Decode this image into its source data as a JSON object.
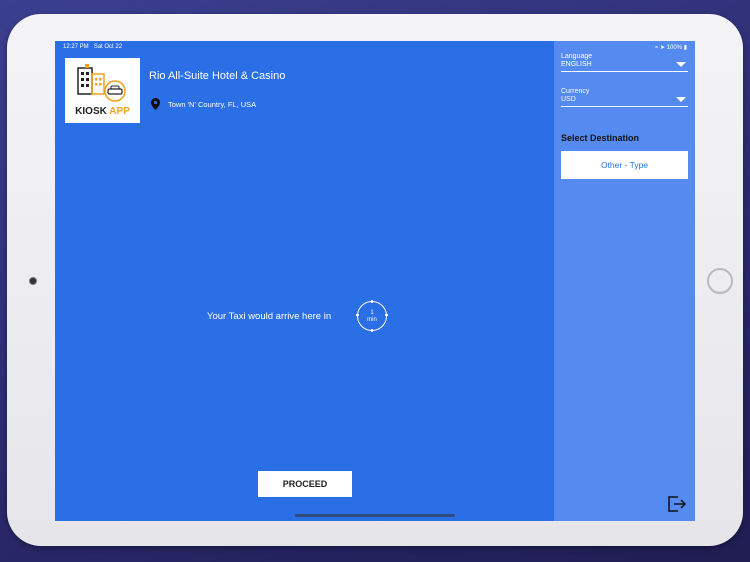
{
  "status_bar": {
    "time": "12:27 PM",
    "date": "Sat Oct 22",
    "battery": "100%"
  },
  "hotel": {
    "name": "Rio All-Suite Hotel & Casino",
    "location": "Town 'N' Country, FL, USA"
  },
  "logo": {
    "text_kiosk": "KIOSK",
    "text_app": "APP"
  },
  "taxi": {
    "arrival_text": "Your Taxi would arrive here in",
    "minutes": "1",
    "unit": "min"
  },
  "actions": {
    "proceed_label": "PROCEED"
  },
  "sidebar": {
    "language_label": "Language",
    "language_value": "ENGLISH",
    "currency_label": "Currency",
    "currency_value": "USD",
    "destination_title": "Select Destination",
    "destination_button": "Other - Type"
  },
  "colors": {
    "main_bg": "#2a6fe6",
    "side_bg": "#558bf0",
    "accent": "#f2a31b"
  }
}
